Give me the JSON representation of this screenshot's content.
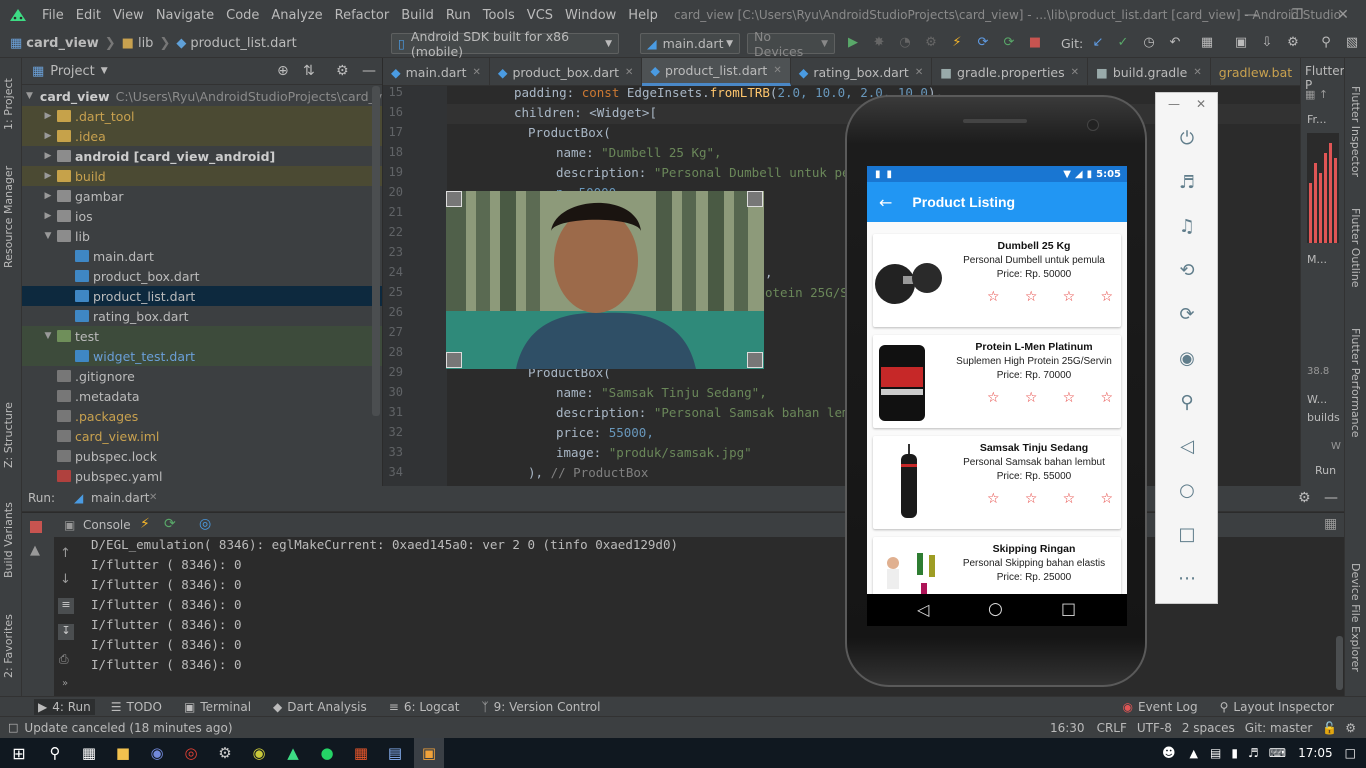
{
  "window": {
    "menu": [
      "File",
      "Edit",
      "View",
      "Navigate",
      "Code",
      "Analyze",
      "Refactor",
      "Build",
      "Run",
      "Tools",
      "VCS",
      "Window",
      "Help"
    ],
    "title": "card_view [C:\\Users\\Ryu\\AndroidStudioProjects\\card_view] - ...\\lib\\product_list.dart [card_view] - Android Studio"
  },
  "toolbar": {
    "breadcrumb": [
      "card_view",
      "lib",
      "product_list.dart"
    ],
    "device": "Android SDK built for x86 (mobile)",
    "config": "main.dart",
    "devices": "No Devices",
    "git_label": "Git:"
  },
  "project": {
    "header": "Project",
    "root_name": "card_view",
    "root_path": "C:\\Users\\Ryu\\AndroidStudioProjects\\card_view",
    "items": [
      {
        "label": "dart_tool",
        "name": ".dart_tool"
      },
      {
        "label": "idea",
        "name": ".idea"
      },
      {
        "label": "android",
        "name": "android [card_view_android]"
      },
      {
        "label": "build",
        "name": "build"
      },
      {
        "label": "gambar",
        "name": "gambar"
      },
      {
        "label": "ios",
        "name": "ios"
      },
      {
        "label": "lib",
        "name": "lib"
      },
      {
        "label": "main",
        "name": "main.dart"
      },
      {
        "label": "product_box",
        "name": "product_box.dart"
      },
      {
        "label": "product_list",
        "name": "product_list.dart"
      },
      {
        "label": "rating_box",
        "name": "rating_box.dart"
      },
      {
        "label": "test",
        "name": "test"
      },
      {
        "label": "widget_test",
        "name": "widget_test.dart"
      },
      {
        "label": "gitignore",
        "name": ".gitignore"
      },
      {
        "label": "metadata",
        "name": ".metadata"
      },
      {
        "label": "packages",
        "name": ".packages"
      },
      {
        "label": "iml",
        "name": "card_view.iml"
      },
      {
        "label": "lock",
        "name": "pubspec.lock"
      },
      {
        "label": "yaml",
        "name": "pubspec.yaml"
      }
    ]
  },
  "tabs": [
    "main.dart",
    "product_box.dart",
    "product_list.dart",
    "rating_box.dart",
    "gradle.properties",
    "build.gradle",
    "gradlew.bat"
  ],
  "editor": {
    "line_numbers": [
      "15",
      "16",
      "17",
      "18",
      "19",
      "20",
      "21",
      "22",
      "23",
      "24",
      "25",
      "26",
      "27",
      "28",
      "29",
      "30",
      "31",
      "32",
      "33",
      "34"
    ],
    "l15_a": "padding: ",
    "l15_b": "const ",
    "l15_c": "EdgeInsets.",
    "l15_d": "fromLTRB",
    "l15_e": "(",
    "l15_f": "2.0, 10.0, 2.0, 10.0",
    "l15_g": "),",
    "l16_a": "children: <Widget>[",
    "l17": "ProductBox(",
    "l18_a": "name: ",
    "l18_b": "\"Dumbell 25 Kg\",",
    "l19_a": "description: ",
    "l19_b": "\"Personal Dumbell untuk pemu",
    "l20": "p  50000,",
    "l24": ",",
    "l25": "otein 25G/S",
    "l29": "ProductBox(",
    "l30_a": "name: ",
    "l30_b": "\"Samsak Tinju Sedang\",",
    "l31_a": "description: ",
    "l31_b": "\"Personal Samsak bahan lembut",
    "l32_a": "price: ",
    "l32_b": "55000,",
    "l33_a": "image: ",
    "l33_b": "\"produk/samsak.jpg\"",
    "l34_a": "), ",
    "l34_b": "// ProductBox"
  },
  "flutter_panel": {
    "title": "Flutter P",
    "fr": "Fr...",
    "m": "M...",
    "w": "W...",
    "builds": "builds",
    "mb": "38.8",
    "run": "Run",
    "w2": "W"
  },
  "run_panel": {
    "label": "Run:",
    "tab": "main.dart",
    "console": "Console",
    "log": [
      "D/EGL_emulation( 8346): eglMakeCurrent: 0xaed145a0: ver 2 0 (tinfo 0xaed129d0)",
      "I/flutter ( 8346): 0",
      "I/flutter ( 8346): 0",
      "I/flutter ( 8346): 0",
      "I/flutter ( 8346): 0",
      "I/flutter ( 8346): 0",
      "I/flutter ( 8346): 0"
    ]
  },
  "bottom_tabs": {
    "run": "4: Run",
    "todo": "TODO",
    "terminal": "Terminal",
    "dart_analysis": "Dart Analysis",
    "logcat": "6: Logcat",
    "vc": "9: Version Control",
    "event_log": "Event Log",
    "layout_inspector": "Layout Inspector"
  },
  "status": {
    "message": "Update canceled (18 minutes ago)",
    "position": "16:30",
    "crlf": "CRLF",
    "encoding": "UTF-8",
    "indent": "2 spaces",
    "git": "Git: master"
  },
  "side_tabs": {
    "project": "1: Project",
    "resource": "Resource Manager",
    "structure": "Z: Structure",
    "build_variants": "Build Variants",
    "favorites": "2: Favorites",
    "flutter_inspector": "Flutter Inspector",
    "flutter_outline": "Flutter Outline",
    "flutter_performance": "Flutter Performance",
    "device_file": "Device File Explorer"
  },
  "phone": {
    "time": "5:05",
    "appbar_title": "Product Listing",
    "products": [
      {
        "name": "Dumbell 25 Kg",
        "description": "Personal Dumbell untuk pemula",
        "price": "Price: Rp. 50000",
        "rating": 0
      },
      {
        "name": "Protein L-Men Platinum",
        "description": "Suplemen High Protein 25G/Servin",
        "price": "Price: Rp. 70000",
        "rating": 0
      },
      {
        "name": "Samsak Tinju Sedang",
        "description": "Personal Samsak bahan lembut",
        "price": "Price: Rp. 55000",
        "rating": 0
      },
      {
        "name": "Skipping Ringan",
        "description": "Personal Skipping bahan elastis",
        "price": "Price: Rp. 25000",
        "rating": 0
      }
    ]
  },
  "taskbar": {
    "time": "17:05"
  }
}
